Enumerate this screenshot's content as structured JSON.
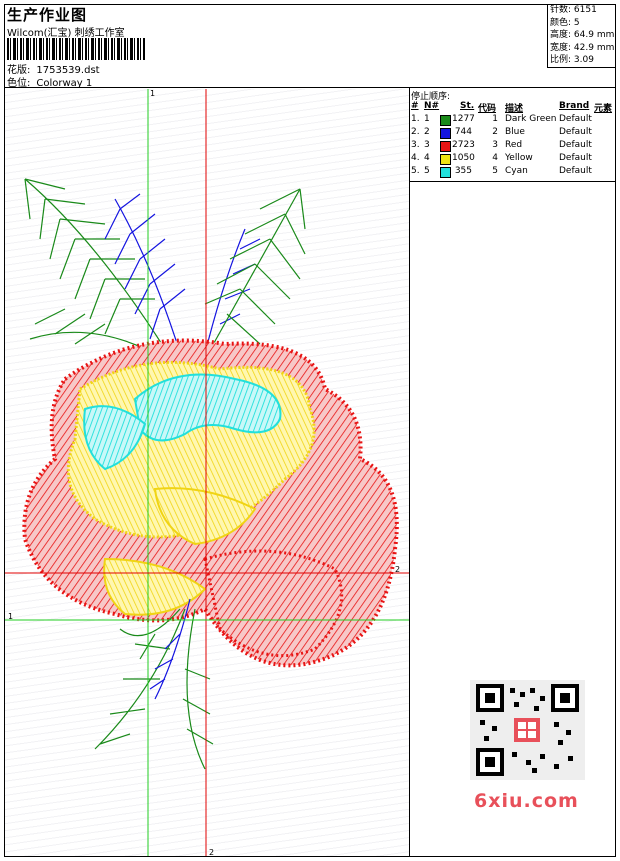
{
  "header": {
    "title": "生产作业图",
    "company": "Wilcom(汇宝) 刺绣工作室",
    "design_label": "花版:",
    "design_value": "1753539.dst",
    "colorway_label": "色位:",
    "colorway_value": "Colorway 1"
  },
  "stats": [
    {
      "label": "针数:",
      "value": "6151"
    },
    {
      "label": "颜色:",
      "value": "5"
    },
    {
      "label": "高度:",
      "value": "64.9 mm"
    },
    {
      "label": "宽度:",
      "value": "42.9 mm"
    },
    {
      "label": "比例:",
      "value": "3.09"
    }
  ],
  "stop_sequence": {
    "title": "停止顺序:",
    "headers": {
      "hash": "#",
      "no": "N#",
      "stitches": "St.",
      "code": "代码",
      "description": "描述",
      "brand": "Brand",
      "element": "元素"
    },
    "rows": [
      {
        "hash": "1.",
        "no": "1",
        "color": "#1a8a1a",
        "stitches": "1277",
        "code": "1",
        "description": "Dark Green",
        "brand": "Default"
      },
      {
        "hash": "2.",
        "no": "2",
        "color": "#1414e0",
        "stitches": "744",
        "code": "2",
        "description": "Blue",
        "brand": "Default"
      },
      {
        "hash": "3.",
        "no": "3",
        "color": "#e81414",
        "stitches": "2723",
        "code": "3",
        "description": "Red",
        "brand": "Default"
      },
      {
        "hash": "4.",
        "no": "4",
        "color": "#f0e414",
        "stitches": "1050",
        "code": "4",
        "description": "Yellow",
        "brand": "Default"
      },
      {
        "hash": "5.",
        "no": "5",
        "color": "#22e0dc",
        "stitches": "355",
        "code": "5",
        "description": "Cyan",
        "brand": "Default"
      }
    ]
  },
  "guides": {
    "v1": "1",
    "v2": "2",
    "h1": "1",
    "h2": "2"
  },
  "watermark": "6xiu.com",
  "colors": {
    "green": "#1a8a1a",
    "blue": "#1414e0",
    "red": "#e81414",
    "yellow": "#f0e414",
    "cyan": "#22e0dc",
    "guide_green": "#22cc22",
    "guide_red": "#e00000"
  }
}
